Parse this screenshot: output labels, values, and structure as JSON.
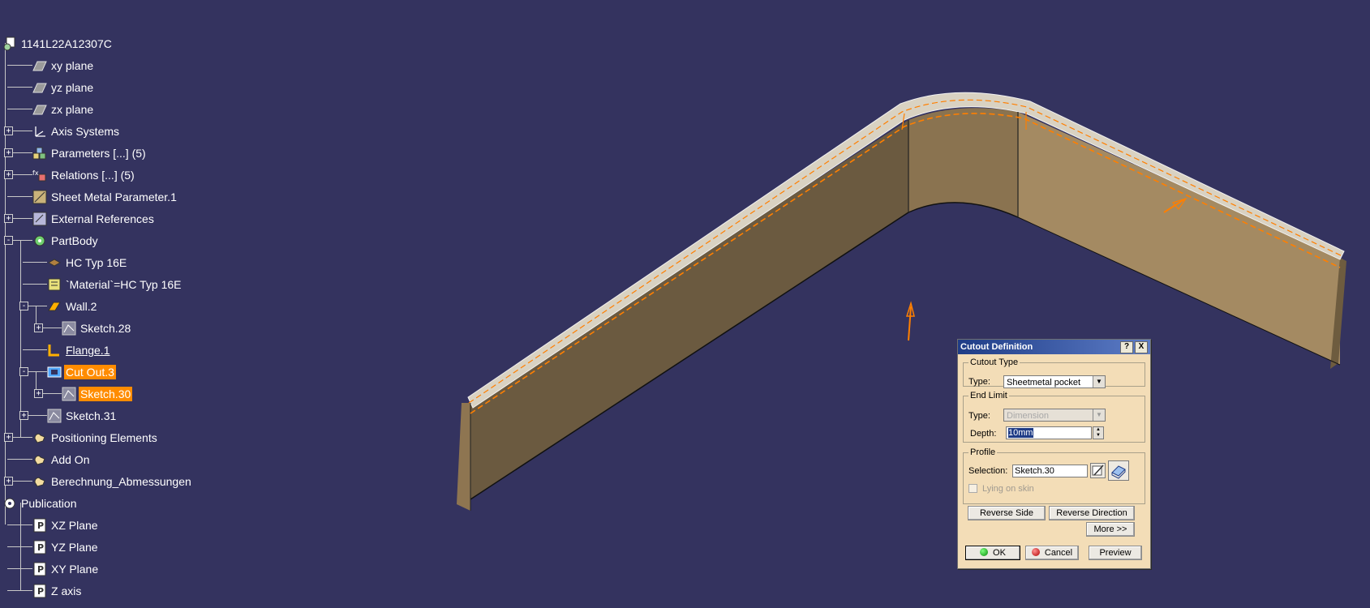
{
  "tree": {
    "root": "1141L22A12307C",
    "items": [
      {
        "label": "xy plane",
        "icon": "plane-icon"
      },
      {
        "label": "yz plane",
        "icon": "plane-icon"
      },
      {
        "label": "zx plane",
        "icon": "plane-icon"
      },
      {
        "label": "Axis Systems",
        "icon": "axis-system-icon"
      },
      {
        "label": "Parameters [...] (5)",
        "icon": "parameters-icon"
      },
      {
        "label": "Relations [...] (5)",
        "icon": "relations-icon"
      },
      {
        "label": "Sheet Metal Parameter.1",
        "icon": "sheet-metal-parameter-icon"
      },
      {
        "label": "External References",
        "icon": "external-references-icon"
      },
      {
        "label": "PartBody",
        "icon": "gear-icon"
      },
      {
        "label": "HC Typ 16E",
        "icon": "material-icon"
      },
      {
        "label": "`Material`=HC Typ 16E",
        "icon": "material-formula-icon"
      },
      {
        "label": "Wall.2",
        "icon": "wall-icon"
      },
      {
        "label": "Sketch.28",
        "icon": "sketch-icon"
      },
      {
        "label": "Flange.1",
        "icon": "flange-icon"
      },
      {
        "label": "Cut Out.3",
        "icon": "cutout-icon"
      },
      {
        "label": "Sketch.30",
        "icon": "sketch-icon"
      },
      {
        "label": "Sketch.31",
        "icon": "sketch-icon"
      },
      {
        "label": "Positioning Elements",
        "icon": "hand-icon"
      },
      {
        "label": "Add On",
        "icon": "hand-icon"
      },
      {
        "label": "Berechnung_Abmessungen",
        "icon": "hand-icon"
      },
      {
        "label": "Publication",
        "icon": "publication-icon"
      },
      {
        "label": "XZ Plane",
        "icon": "publication-item-icon"
      },
      {
        "label": "YZ Plane",
        "icon": "publication-item-icon"
      },
      {
        "label": "XY Plane",
        "icon": "publication-item-icon"
      },
      {
        "label": "Z axis",
        "icon": "publication-item-icon"
      }
    ]
  },
  "dialog": {
    "title": "Cutout Definition",
    "help_label": "?",
    "close_label": "X",
    "cutout_type": {
      "legend": "Cutout Type",
      "type_label": "Type:",
      "type_value": "Sheetmetal pocket"
    },
    "end_limit": {
      "legend": "End Limit",
      "type_label": "Type:",
      "type_value": "Dimension",
      "depth_label": "Depth:",
      "depth_value": "10mm"
    },
    "profile": {
      "legend": "Profile",
      "selection_label": "Selection:",
      "selection_value": "Sketch.30",
      "lying_on_skin_label": "Lying on skin",
      "lying_on_skin_checked": false
    },
    "reverse_side_label": "Reverse Side",
    "reverse_direction_label": "Reverse Direction",
    "more_label": "More >>",
    "ok_label": "OK",
    "cancel_label": "Cancel",
    "preview_label": "Preview"
  },
  "colors": {
    "background": "#34335f",
    "selection": "#ff8c00",
    "dialog": "#f3ddb7",
    "part_face_light": "#a48a62",
    "part_face_dark": "#5f4f38"
  }
}
